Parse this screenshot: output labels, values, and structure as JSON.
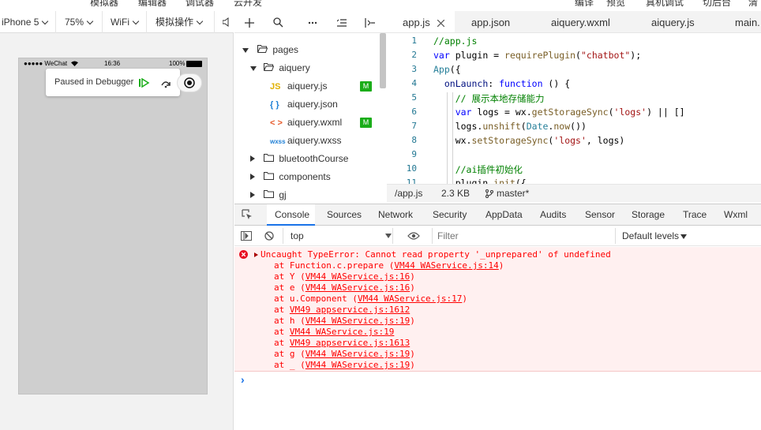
{
  "top_menu": [
    "模拟器",
    "编辑器",
    "调试器",
    "云开发",
    "编译",
    "预览",
    "真机调试",
    "切后台",
    "清缓"
  ],
  "device_toolbar": {
    "device": "iPhone 5",
    "zoom": "75%",
    "network": "WiFi",
    "operation": "模拟操作"
  },
  "phone": {
    "carrier": "●●●●● WeChat",
    "time": "16:36",
    "battery": "100%",
    "debug_text": "Paused in Debugger"
  },
  "tree": {
    "items": [
      {
        "label": "pages"
      },
      {
        "label": "aiquery"
      },
      {
        "label": "aiquery.js",
        "icon": "JS",
        "badge": "M"
      },
      {
        "label": "aiquery.json",
        "icon": "{ }"
      },
      {
        "label": "aiquery.wxml",
        "icon": "< >",
        "badge": "M"
      },
      {
        "label": "aiquery.wxss",
        "icon": "wxss"
      },
      {
        "label": "bluetoothCourse"
      },
      {
        "label": "components"
      },
      {
        "label": "gj"
      }
    ]
  },
  "editor": {
    "tabs": [
      "app.js",
      "app.json",
      "aiquery.wxml",
      "aiquery.js",
      "main."
    ],
    "line_numbers": [
      "1",
      "2",
      "3",
      "4",
      "5",
      "6",
      "7",
      "8",
      "9",
      "10",
      "11"
    ],
    "status": {
      "path": "/app.js",
      "size": "2.3 KB",
      "branch": "master*"
    }
  },
  "devtools": {
    "tabs": [
      "Console",
      "Sources",
      "Network",
      "Security",
      "AppData",
      "Audits",
      "Sensor",
      "Storage",
      "Trace",
      "Wxml"
    ],
    "context": "top",
    "filter_placeholder": "Filter",
    "levels": "Default levels",
    "error": {
      "message": "Uncaught TypeError: Cannot read property '_unprepared' of undefined",
      "stack": [
        {
          "prefix": "at Function.c.prepare (",
          "link": "VM44 WAService.js:14",
          "suffix": ")"
        },
        {
          "prefix": "at Y (",
          "link": "VM44 WAService.js:16",
          "suffix": ")"
        },
        {
          "prefix": "at e (",
          "link": "VM44 WAService.js:16",
          "suffix": ")"
        },
        {
          "prefix": "at u.Component (",
          "link": "VM44 WAService.js:17",
          "suffix": ")"
        },
        {
          "prefix": "at ",
          "link": "VM49 appservice.js:1612",
          "suffix": ""
        },
        {
          "prefix": "at h (",
          "link": "VM44 WAService.js:19",
          "suffix": ")"
        },
        {
          "prefix": "at ",
          "link": "VM44 WAService.js:19",
          "suffix": ""
        },
        {
          "prefix": "at ",
          "link": "VM49 appservice.js:1613",
          "suffix": ""
        },
        {
          "prefix": "at g (",
          "link": "VM44 WAService.js:19",
          "suffix": ")"
        },
        {
          "prefix": "at _ (",
          "link": "VM44 WAService.js:19",
          "suffix": ")"
        }
      ]
    },
    "prompt": "›"
  },
  "colors": {
    "accent": "#1aad19",
    "error": "#ff0000",
    "error_bg": "#fff0f0"
  }
}
